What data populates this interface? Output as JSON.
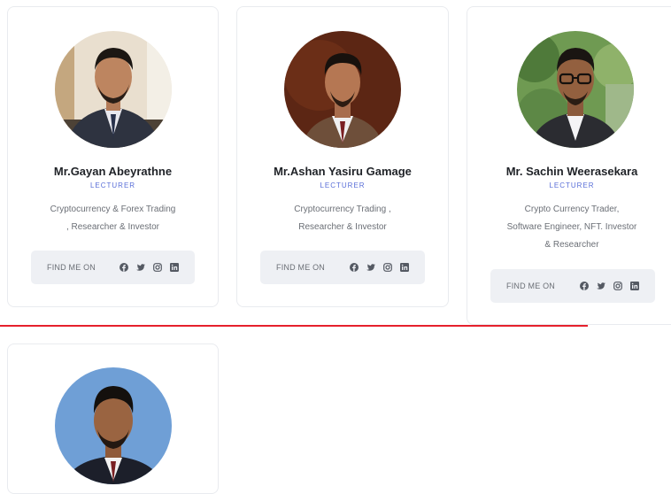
{
  "accent_color": "#5a6fd8",
  "divider_color": "#e5202c",
  "members": [
    {
      "name": "Mr.Gayan Abeyrathne",
      "role": "LECTURER",
      "desc": [
        "Cryptocurrency & Forex Trading",
        ", Researcher & Investor"
      ],
      "find_label": "FIND ME ON",
      "social": [
        "facebook-icon",
        "twitter-icon",
        "instagram-icon",
        "linkedin-icon"
      ]
    },
    {
      "name": "Mr.Ashan Yasiru Gamage",
      "role": "LECTURER",
      "desc": [
        "Cryptocurrency Trading ,",
        "Researcher & Investor"
      ],
      "find_label": "FIND ME ON",
      "social": [
        "facebook-icon",
        "twitter-icon",
        "instagram-icon",
        "linkedin-icon"
      ]
    },
    {
      "name": "Mr. Sachin Weerasekara",
      "role": "LECTURER",
      "desc": [
        "Crypto Currency Trader,",
        "Software Engineer, NFT. Investor",
        "& Researcher"
      ],
      "find_label": "FIND ME ON",
      "social": [
        "facebook-icon",
        "twitter-icon",
        "instagram-icon",
        "linkedin-icon"
      ]
    }
  ]
}
